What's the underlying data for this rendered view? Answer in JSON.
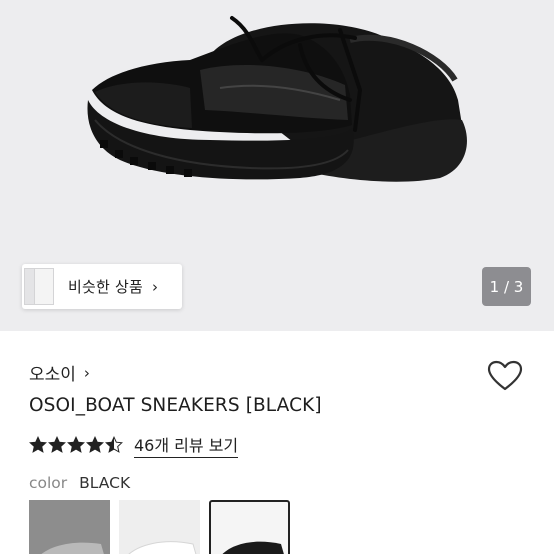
{
  "gallery": {
    "pager_text": "1 / 3",
    "similar_label": "비슷한 상품",
    "similar_chevron": "›",
    "background_color": "#ededef"
  },
  "product": {
    "brand": "오소이",
    "brand_chevron": "›",
    "title": "OSOI_BOAT SNEAKERS [BLACK]",
    "rating": 4.5,
    "star_color": "#222222",
    "review_link": "46개 리뷰 보기",
    "color_key": "color",
    "color_value": "BLACK",
    "swatches": [
      {
        "name": "gray",
        "selected": false
      },
      {
        "name": "white",
        "selected": false
      },
      {
        "name": "black",
        "selected": true
      }
    ]
  },
  "icons": {
    "wishlist": "heart-icon",
    "star": "star-icon"
  }
}
